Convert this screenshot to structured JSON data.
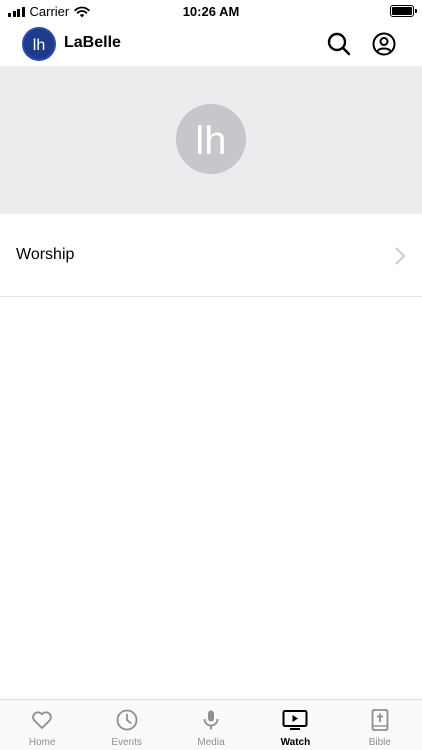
{
  "status_bar": {
    "carrier": "Carrier",
    "time": "10:26 AM"
  },
  "header": {
    "title": "LaBelle",
    "logo_text": "lh"
  },
  "hero": {
    "logo_text": "lh"
  },
  "list": {
    "items": [
      {
        "label": "Worship"
      }
    ]
  },
  "tabbar": {
    "active": "Watch",
    "tabs": [
      {
        "label": "Home",
        "icon": "heart-icon"
      },
      {
        "label": "Events",
        "icon": "clock-icon"
      },
      {
        "label": "Media",
        "icon": "microphone-icon"
      },
      {
        "label": "Watch",
        "icon": "video-play-icon"
      },
      {
        "label": "Bible",
        "icon": "bible-icon"
      }
    ]
  },
  "colors": {
    "brand": "#1f3a8a",
    "hero_bg": "#ebecee",
    "inactive_tab": "#8e8e93"
  }
}
